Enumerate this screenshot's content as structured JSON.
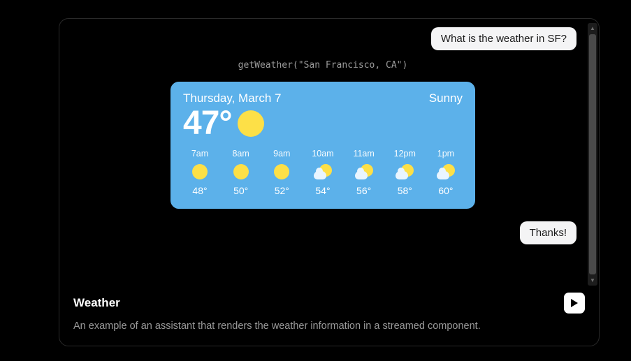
{
  "chat": {
    "user_message_1": "What is the weather in SF?",
    "tool_call": "getWeather(\"San Francisco, CA\")",
    "user_message_2": "Thanks!"
  },
  "weather": {
    "date": "Thursday, March 7",
    "condition": "Sunny",
    "current_temp": "47°",
    "hours": [
      {
        "label": "7am",
        "temp": "48°",
        "icon": "sunny"
      },
      {
        "label": "8am",
        "temp": "50°",
        "icon": "sunny"
      },
      {
        "label": "9am",
        "temp": "52°",
        "icon": "sunny"
      },
      {
        "label": "10am",
        "temp": "54°",
        "icon": "partly"
      },
      {
        "label": "11am",
        "temp": "56°",
        "icon": "partly"
      },
      {
        "label": "12pm",
        "temp": "58°",
        "icon": "partly"
      },
      {
        "label": "1pm",
        "temp": "60°",
        "icon": "partly"
      }
    ]
  },
  "footer": {
    "title": "Weather",
    "description": "An example of an assistant that renders the weather information in a streamed component."
  }
}
